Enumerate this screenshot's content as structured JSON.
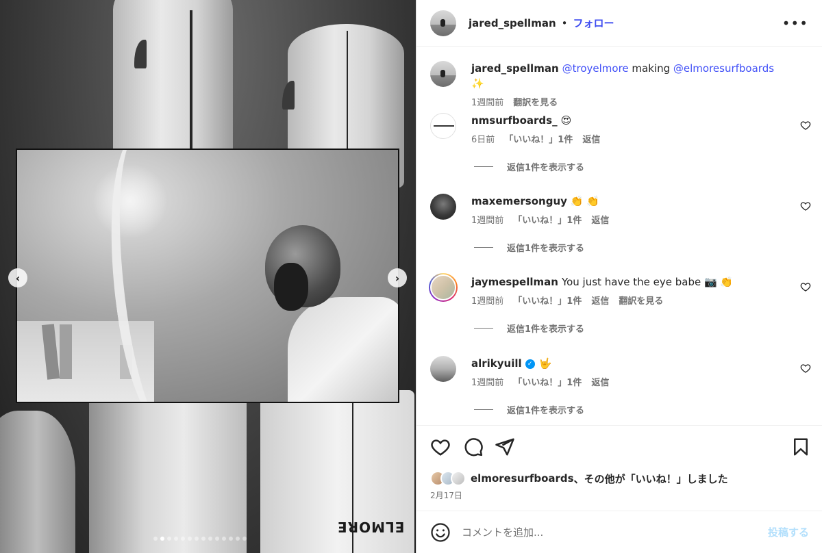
{
  "post": {
    "username": "jared_spellman",
    "separator": "•",
    "follow_label": "フォロー",
    "more_label": "•••"
  },
  "caption": {
    "username": "jared_spellman",
    "mention1": "@troyelmore",
    "text_mid": " making ",
    "mention2": "@elmoresurfboards",
    "emoji": "✨",
    "time": "1週間前",
    "translate": "翻訳を見る"
  },
  "comments": [
    {
      "username": "nmsurfboards_",
      "text": "😍",
      "time": "6日前",
      "likes": "「いいね！」1件",
      "reply": "返信",
      "view_replies": "返信1件を表示する"
    },
    {
      "username": "maxemersonguy",
      "text": "👏 👏",
      "time": "1週間前",
      "likes": "「いいね！」1件",
      "reply": "返信",
      "view_replies": "返信1件を表示する"
    },
    {
      "username": "jaymespellman",
      "text": "You just have the eye babe 📷 👏",
      "time": "1週間前",
      "likes": "「いいね！」1件",
      "reply": "返信",
      "translate": "翻訳を見る",
      "view_replies": "返信1件を表示する"
    },
    {
      "username": "alrikyuill",
      "verified_mark": "✓",
      "text": "🤟",
      "time": "1週間前",
      "likes": "「いいね！」1件",
      "reply": "返信",
      "view_replies": "返信1件を表示する"
    }
  ],
  "likes_summary": {
    "user": "elmoresurfboards",
    "rest": "、その他が「いいね！」しました"
  },
  "date": "2月17日",
  "add_comment": {
    "placeholder": "コメントを追加...",
    "post_label": "投稿する"
  },
  "media": {
    "carousel_count": 14,
    "carousel_active_index": 1,
    "prev_arrow": "‹",
    "next_arrow": "›",
    "brand_mark": "ELMORE"
  },
  "icons": {
    "like": "heart-icon",
    "comment": "comment-icon",
    "share": "share-icon",
    "save": "bookmark-icon",
    "emoji": "emoji-icon"
  },
  "colors": {
    "link": "#3f4df0",
    "muted": "#737373",
    "post_disabled": "#b2dffc"
  }
}
